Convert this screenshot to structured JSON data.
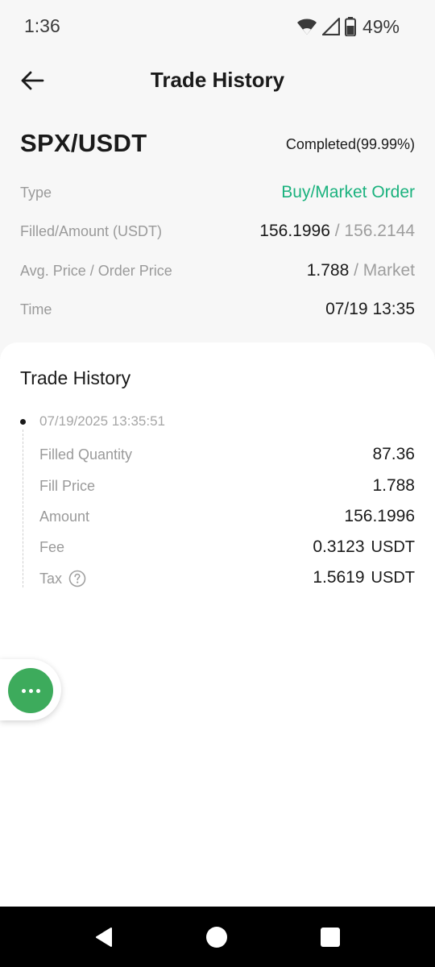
{
  "status_bar": {
    "time": "1:36",
    "battery": "49%",
    "icons": [
      "wifi-icon",
      "cell-signal-icon",
      "battery-icon"
    ]
  },
  "header": {
    "title": "Trade History",
    "back_icon": "arrow-left-icon"
  },
  "order": {
    "pair": "SPX/USDT",
    "status": "Completed(99.99%)",
    "type_label": "Type",
    "type_value": "Buy/Market Order",
    "filled_label": "Filled/Amount (USDT)",
    "filled_value": "156.1996",
    "amount_value": "/ 156.2144",
    "price_label": "Avg. Price / Order Price",
    "avg_price": "1.788",
    "order_price": "/ Market",
    "time_label": "Time",
    "time_value": "07/19 13:35"
  },
  "trade_history": {
    "title": "Trade History",
    "fills": [
      {
        "timestamp": "07/19/2025 13:35:51",
        "quantity_label": "Filled Quantity",
        "quantity": "87.36",
        "price_label": "Fill Price",
        "price": "1.788",
        "amount_label": "Amount",
        "amount": "156.1996",
        "fee_label": "Fee",
        "fee": "0.3123",
        "fee_unit": "USDT",
        "tax_label": "Tax",
        "tax": "1.5619",
        "tax_unit": "USDT"
      }
    ]
  },
  "fab": {
    "icon": "more-dots-icon"
  },
  "colors": {
    "accent_green": "#1bb27e",
    "fab_green": "#3dab5c",
    "background": "#f7f7f7",
    "card": "#ffffff"
  }
}
